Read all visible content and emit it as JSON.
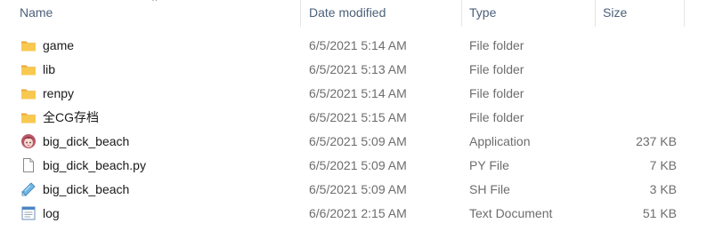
{
  "columns": {
    "name": "Name",
    "date": "Date modified",
    "type": "Type",
    "size": "Size"
  },
  "files": [
    {
      "name": "game",
      "date": "6/5/2021 5:14 AM",
      "type": "File folder",
      "size": "",
      "icon": "folder-icon"
    },
    {
      "name": "lib",
      "date": "6/5/2021 5:13 AM",
      "type": "File folder",
      "size": "",
      "icon": "folder-icon"
    },
    {
      "name": "renpy",
      "date": "6/5/2021 5:14 AM",
      "type": "File folder",
      "size": "",
      "icon": "folder-icon"
    },
    {
      "name": "全CG存档",
      "date": "6/5/2021 5:15 AM",
      "type": "File folder",
      "size": "",
      "icon": "folder-icon"
    },
    {
      "name": "big_dick_beach",
      "date": "6/5/2021 5:09 AM",
      "type": "Application",
      "size": "237 KB",
      "icon": "application-icon"
    },
    {
      "name": "big_dick_beach.py",
      "date": "6/5/2021 5:09 AM",
      "type": "PY File",
      "size": "7 KB",
      "icon": "generic-file-icon"
    },
    {
      "name": "big_dick_beach",
      "date": "6/5/2021 5:09 AM",
      "type": "SH File",
      "size": "3 KB",
      "icon": "shell-script-icon"
    },
    {
      "name": "log",
      "date": "6/6/2021 2:15 AM",
      "type": "Text Document",
      "size": "51 KB",
      "icon": "text-document-icon"
    }
  ],
  "colors": {
    "header_text": "#4c607a",
    "detail_text": "#6d6d6d",
    "folder_yellow": "#f8c951",
    "folder_dark": "#e8a93a"
  }
}
